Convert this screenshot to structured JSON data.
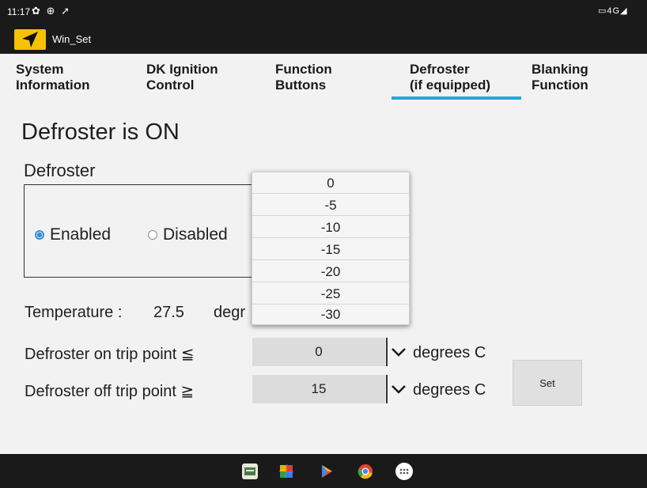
{
  "status_bar": {
    "time": "11:17",
    "left_icons": [
      "gear-icon",
      "vpn-icon",
      "location-arrow-icon"
    ],
    "right_text": "4G"
  },
  "app": {
    "title": "Win_Set",
    "icon": "navigation-arrow-icon",
    "brand_color": "#f5c100"
  },
  "tabs": [
    {
      "line1": "System",
      "line2": "Information",
      "selected": false
    },
    {
      "line1": "DK Ignition",
      "line2": "Control",
      "selected": false
    },
    {
      "line1": "Function",
      "line2": "Buttons",
      "selected": false
    },
    {
      "line1": "Defroster",
      "line2": "(if equipped)",
      "selected": true
    },
    {
      "line1": "Blanking",
      "line2": "Function",
      "selected": false
    }
  ],
  "accent_color": "#26a6d6",
  "main": {
    "state_title": "Defroster is ON",
    "defroster_label": "Defroster",
    "radio": {
      "enabled_label": "Enabled",
      "disabled_label": "Disabled",
      "selected": "Enabled"
    },
    "temperature": {
      "label": "Temperature :",
      "value": "27.5",
      "unit_partial": "degr"
    },
    "on_trip": {
      "label": "Defroster on trip point ≦",
      "value": "0",
      "unit": "degrees C"
    },
    "off_trip": {
      "label": "Defroster off trip point ≧",
      "value": "15",
      "unit": "degrees C"
    },
    "set_label": "Set"
  },
  "dropdown": {
    "options": [
      "0",
      "-5",
      "-10",
      "-15",
      "-20",
      "-25",
      "-30"
    ]
  },
  "nav_bar": {
    "apps": [
      "files-icon",
      "photos-icon",
      "play-store-icon",
      "chrome-icon",
      "app-drawer-icon"
    ]
  }
}
